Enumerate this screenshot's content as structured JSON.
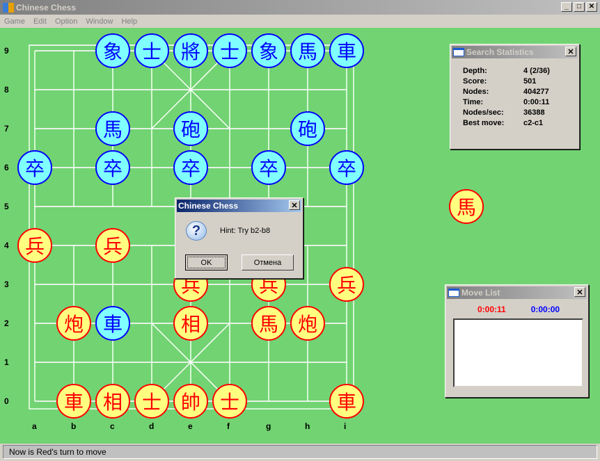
{
  "window": {
    "title": "Chinese Chess",
    "minimize": "_",
    "maximize": "□",
    "close": "✕"
  },
  "menu": [
    "Game",
    "Edit",
    "Option",
    "Window",
    "Help"
  ],
  "board": {
    "files": [
      "a",
      "b",
      "c",
      "d",
      "e",
      "f",
      "g",
      "h",
      "i"
    ],
    "ranks": [
      "0",
      "1",
      "2",
      "3",
      "4",
      "5",
      "6",
      "7",
      "8",
      "9"
    ],
    "pieces": [
      {
        "file": 2,
        "rank": 9,
        "side": "blue",
        "char": "象"
      },
      {
        "file": 3,
        "rank": 9,
        "side": "blue",
        "char": "士"
      },
      {
        "file": 4,
        "rank": 9,
        "side": "blue",
        "char": "將"
      },
      {
        "file": 5,
        "rank": 9,
        "side": "blue",
        "char": "士"
      },
      {
        "file": 6,
        "rank": 9,
        "side": "blue",
        "char": "象"
      },
      {
        "file": 7,
        "rank": 9,
        "side": "blue",
        "char": "馬"
      },
      {
        "file": 8,
        "rank": 9,
        "side": "blue",
        "char": "車"
      },
      {
        "file": 2,
        "rank": 7,
        "side": "blue",
        "char": "馬"
      },
      {
        "file": 4,
        "rank": 7,
        "side": "blue",
        "char": "砲"
      },
      {
        "file": 7,
        "rank": 7,
        "side": "blue",
        "char": "砲"
      },
      {
        "file": 0,
        "rank": 6,
        "side": "blue",
        "char": "卒"
      },
      {
        "file": 2,
        "rank": 6,
        "side": "blue",
        "char": "卒"
      },
      {
        "file": 4,
        "rank": 6,
        "side": "blue",
        "char": "卒"
      },
      {
        "file": 6,
        "rank": 6,
        "side": "blue",
        "char": "卒"
      },
      {
        "file": 8,
        "rank": 6,
        "side": "blue",
        "char": "卒"
      },
      {
        "file": 0,
        "rank": 4,
        "side": "red",
        "char": "兵"
      },
      {
        "file": 2,
        "rank": 4,
        "side": "red",
        "char": "兵"
      },
      {
        "file": 4,
        "rank": 3,
        "side": "red",
        "char": "兵"
      },
      {
        "file": 6,
        "rank": 3,
        "side": "red",
        "char": "兵"
      },
      {
        "file": 8,
        "rank": 3,
        "side": "red",
        "char": "兵"
      },
      {
        "file": 1,
        "rank": 2,
        "side": "red",
        "char": "炮"
      },
      {
        "file": 2,
        "rank": 2,
        "side": "blue",
        "char": "車"
      },
      {
        "file": 4,
        "rank": 2,
        "side": "red",
        "char": "相"
      },
      {
        "file": 6,
        "rank": 2,
        "side": "red",
        "char": "馬"
      },
      {
        "file": 7,
        "rank": 2,
        "side": "red",
        "char": "炮"
      },
      {
        "file": 1,
        "rank": 0,
        "side": "red",
        "char": "車"
      },
      {
        "file": 2,
        "rank": 0,
        "side": "red",
        "char": "相"
      },
      {
        "file": 3,
        "rank": 0,
        "side": "red",
        "char": "士"
      },
      {
        "file": 4,
        "rank": 0,
        "side": "red",
        "char": "帥"
      },
      {
        "file": 5,
        "rank": 0,
        "side": "red",
        "char": "士"
      },
      {
        "file": 8,
        "rank": 0,
        "side": "red",
        "char": "車"
      }
    ],
    "captured": [
      {
        "side": "red",
        "char": "馬"
      }
    ]
  },
  "search_stats": {
    "title": "Search Statistics",
    "rows": [
      {
        "label": "Depth:",
        "value": "4  (2/36)"
      },
      {
        "label": "Score:",
        "value": "501"
      },
      {
        "label": "Nodes:",
        "value": "404277"
      },
      {
        "label": "Time:",
        "value": "0:00:11"
      },
      {
        "label": "Nodes/sec:",
        "value": "36388"
      },
      {
        "label": "Best move:",
        "value": "c2-c1"
      }
    ]
  },
  "move_list": {
    "title": "Move List",
    "red_time": "0:00:11",
    "blue_time": "0:00:00",
    "red_color": "#ff0000",
    "blue_color": "#0000ff"
  },
  "dialog": {
    "title": "Chinese Chess",
    "message": "Hint: Try b2-b8",
    "ok": "OK",
    "cancel": "Отмена",
    "icon": "question-icon"
  },
  "status": "Now is Red's turn to move"
}
